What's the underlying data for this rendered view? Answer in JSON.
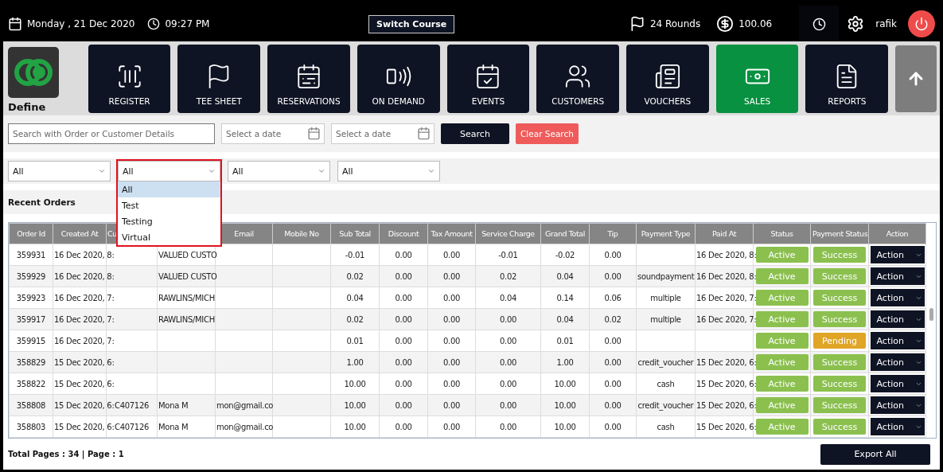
{
  "header": {
    "date": "Monday ,  21 Dec 2020",
    "time": "09:27 PM",
    "switch_course": "Switch Course",
    "rounds": "24 Rounds",
    "balance": "100.06",
    "user": "rafik"
  },
  "nav": {
    "logo_label": "Define",
    "tiles": [
      {
        "label": "REGISTER",
        "selected": false
      },
      {
        "label": "TEE SHEET",
        "selected": false
      },
      {
        "label": "RESERVATIONS",
        "selected": false
      },
      {
        "label": "ON DEMAND",
        "selected": false
      },
      {
        "label": "EVENTS",
        "selected": false
      },
      {
        "label": "CUSTOMERS",
        "selected": false
      },
      {
        "label": "VOUCHERS",
        "selected": false
      },
      {
        "label": "SALES",
        "selected": true
      },
      {
        "label": "REPORTS",
        "selected": false
      }
    ]
  },
  "search": {
    "placeholder": "Search with Order or Customer Details",
    "date_from": {
      "placeholder": "Select a date"
    },
    "date_to": {
      "placeholder": "Select a date"
    },
    "search_button": "Search",
    "clear_button": "Clear Search"
  },
  "filters": [
    {
      "value": "All",
      "open": false
    },
    {
      "value": "All",
      "open": true,
      "options": [
        {
          "label": "All",
          "selected": true
        },
        {
          "label": "Test",
          "selected": false
        },
        {
          "label": "Testing",
          "selected": false
        },
        {
          "label": "Virtual",
          "selected": false
        }
      ]
    },
    {
      "value": "All",
      "open": false
    },
    {
      "value": "All",
      "open": false
    }
  ],
  "section_title": "Recent Orders",
  "table": {
    "columns": [
      {
        "label": "Order Id"
      },
      {
        "label": "Created At"
      },
      {
        "label": "Cu"
      },
      {},
      {
        "label": "Email"
      },
      {
        "label": "Mobile No"
      },
      {
        "label": "Sub Total"
      },
      {
        "label": "Discount"
      },
      {
        "label": "Tax Amount"
      },
      {
        "label": "Service Charge"
      },
      {
        "label": "Grand Total"
      },
      {
        "label": "Tip"
      },
      {
        "label": "Payment Type"
      },
      {
        "label": "Paid At"
      },
      {
        "label": "Status"
      },
      {
        "label": "Payment Status"
      },
      {
        "label": "Action"
      }
    ],
    "rows": [
      {
        "cells": [
          "359931",
          "16 Dec 2020, 8:",
          null,
          "VALUED CUSTO",
          null,
          null,
          "-0.01",
          "0.00",
          "0.00",
          "-0.01",
          "-0.02",
          "0.00",
          null,
          "16 Dec 2020, 8:"
        ],
        "status": "Active",
        "payment_status": {
          "label": "Success",
          "kind": "success"
        },
        "action": "Action"
      },
      {
        "cells": [
          "359929",
          "16 Dec 2020, 8:",
          null,
          "VALUED CUSTO",
          null,
          null,
          "0.02",
          "0.00",
          "0.00",
          "0.02",
          "0.04",
          "0.00",
          "soundpayment",
          "16 Dec 2020, 8:"
        ],
        "status": "Active",
        "payment_status": {
          "label": "Success",
          "kind": "success"
        },
        "action": "Action"
      },
      {
        "cells": [
          "359923",
          "16 Dec 2020, 7:",
          null,
          "RAWLINS/MICH",
          null,
          null,
          "0.04",
          "0.00",
          "0.00",
          "0.04",
          "0.14",
          "0.06",
          "multiple",
          "16 Dec 2020, 7:"
        ],
        "status": "Active",
        "payment_status": {
          "label": "Success",
          "kind": "success"
        },
        "action": "Action"
      },
      {
        "cells": [
          "359917",
          "16 Dec 2020, 7:",
          null,
          "RAWLINS/MICH",
          null,
          null,
          "0.02",
          "0.00",
          "0.00",
          "0.00",
          "0.04",
          "0.02",
          "multiple",
          "16 Dec 2020, 7:"
        ],
        "status": "Active",
        "payment_status": {
          "label": "Success",
          "kind": "success"
        },
        "action": "Action"
      },
      {
        "cells": [
          "359915",
          "16 Dec 2020, 7:",
          null,
          null,
          null,
          null,
          "0.01",
          "0.00",
          "0.00",
          "0.00",
          "0.01",
          "0.00",
          null,
          null
        ],
        "status": "Active",
        "payment_status": {
          "label": "Pending",
          "kind": "pending"
        },
        "action": "Action"
      },
      {
        "cells": [
          "358829",
          "15 Dec 2020, 6:",
          null,
          null,
          null,
          null,
          "1.00",
          "0.00",
          "0.00",
          "0.00",
          "1.00",
          "0.00",
          "credit_voucher",
          "15 Dec 2020, 6:"
        ],
        "status": "Active",
        "payment_status": {
          "label": "Success",
          "kind": "success"
        },
        "action": "Action"
      },
      {
        "cells": [
          "358822",
          "15 Dec 2020, 6:",
          null,
          null,
          null,
          null,
          "10.00",
          "0.00",
          "0.00",
          "0.00",
          "10.00",
          "0.00",
          "cash",
          "15 Dec 2020, 6:"
        ],
        "status": "Active",
        "payment_status": {
          "label": "Success",
          "kind": "success"
        },
        "action": "Action"
      },
      {
        "cells": [
          "358808",
          "15 Dec 2020, 6:",
          "C407126",
          "Mona M",
          "mon@gmail.co",
          null,
          "10.00",
          "0.00",
          "0.00",
          "0.00",
          "10.00",
          "0.00",
          "credit_voucher",
          "15 Dec 2020, 6:"
        ],
        "status": "Active",
        "payment_status": {
          "label": "Success",
          "kind": "success"
        },
        "action": "Action"
      },
      {
        "cells": [
          "358803",
          "15 Dec 2020, 6:",
          "C407126",
          "Mona M",
          "mon@gmail.co",
          null,
          "10.00",
          "0.00",
          "0.00",
          "0.00",
          "10.00",
          "0.00",
          "cash",
          "15 Dec 2020, 6:"
        ],
        "status": "Active",
        "payment_status": {
          "label": "Success",
          "kind": "success"
        },
        "action": "Action"
      }
    ]
  },
  "footer": {
    "pages": "Total Pages : 34 | Page : 1",
    "export_button": "Export All"
  }
}
